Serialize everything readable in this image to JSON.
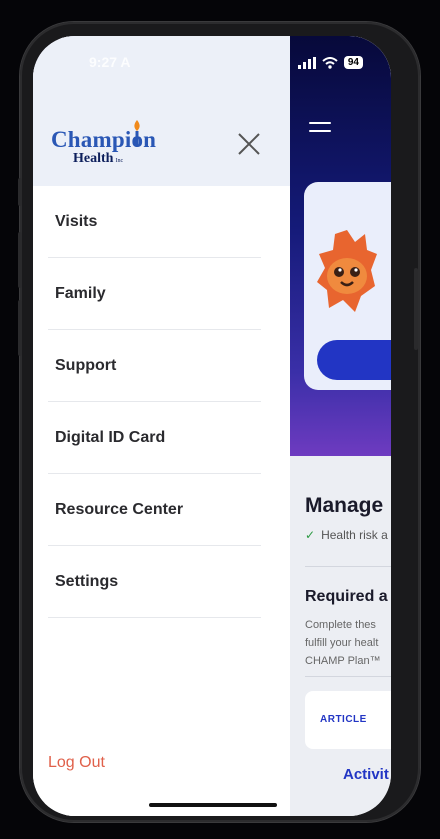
{
  "status_bar": {
    "time": "9:27 A",
    "battery": "94"
  },
  "drawer": {
    "logo": {
      "line1": "Champion",
      "line2": "Health",
      "suffix": "Inc"
    },
    "menu_items": [
      {
        "label": "Visits"
      },
      {
        "label": "Family"
      },
      {
        "label": "Support"
      },
      {
        "label": "Digital ID Card"
      },
      {
        "label": "Resource Center"
      },
      {
        "label": "Settings"
      }
    ],
    "logout_label": "Log Out"
  },
  "background_app": {
    "manage_title": "Manage",
    "health_risk_text": "Health risk a",
    "required_title": "Required a",
    "required_body_lines": [
      "Complete thes",
      "fulfill your healt",
      "CHAMP Plan™"
    ],
    "article_tag": "ARTICLE",
    "activity_link": "Activit"
  },
  "colors": {
    "accent": "#2235c4",
    "logout": "#e0604a",
    "drawer_header_bg": "#ecf0f8",
    "app_header_dark": "#07093a"
  }
}
